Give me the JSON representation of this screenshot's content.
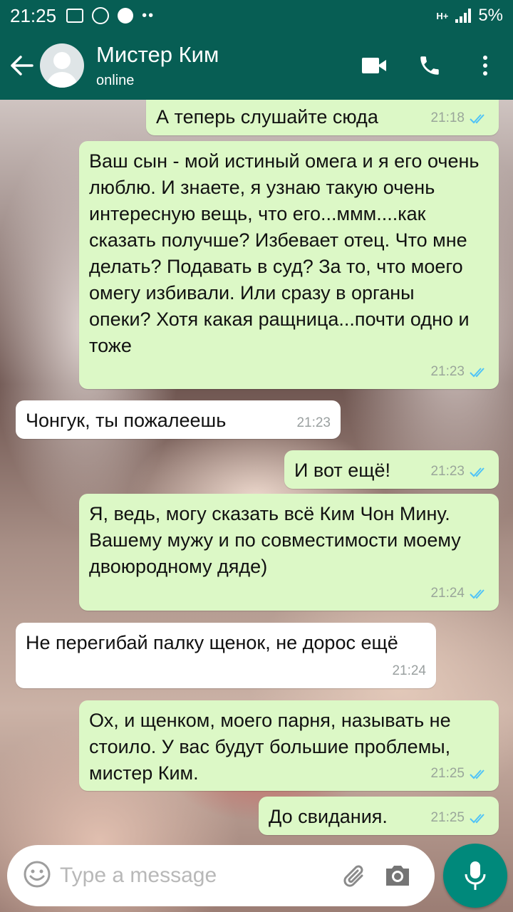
{
  "status_bar": {
    "time": "21:25",
    "network": "H+",
    "battery": "5%"
  },
  "header": {
    "contact_name": "Мистер Ким",
    "contact_status": "online"
  },
  "messages": [
    {
      "direction": "out",
      "text": "А теперь слушайте сюда",
      "time": "21:18",
      "read": true
    },
    {
      "direction": "out",
      "text": "Ваш сын - мой истиный омега и я его очень люблю. И знаете, я узнаю такую очень интересную вещь, что его...ммм....как сказать получше? Избевает отец. Что мне делать? Подавать в суд? За то, что моего омегу избивали. Или сразу в органы опеки? Хотя какая ращница...почти одно и тоже",
      "time": "21:23",
      "read": true
    },
    {
      "direction": "in",
      "text": "Чонгук, ты пожалеешь",
      "time": "21:23"
    },
    {
      "direction": "out",
      "text": "И вот ещё!",
      "time": "21:23",
      "read": true
    },
    {
      "direction": "out",
      "text": "Я, ведь, могу сказать всё Ким Чон Мину. Вашему мужу и по совместимости моему двоюродному дяде)",
      "time": "21:24",
      "read": true
    },
    {
      "direction": "in",
      "text": "Не перегибай палку щенок, не дорос ещё",
      "time": "21:24"
    },
    {
      "direction": "out",
      "text": "Ох, и щенком, моего парня, называть не стоило. У вас будут большие проблемы, мистер Ким.",
      "time": "21:25",
      "read": true
    },
    {
      "direction": "out",
      "text": "До свидания.",
      "time": "21:25",
      "read": true
    }
  ],
  "input": {
    "placeholder": "Type a message",
    "value": ""
  },
  "icons": {
    "back": "arrow-left-icon",
    "video": "video-call-icon",
    "call": "phone-icon",
    "menu": "more-vertical-icon",
    "emoji": "emoji-icon",
    "attach": "paperclip-icon",
    "camera": "camera-icon",
    "mic": "microphone-icon"
  },
  "colors": {
    "header": "#075e54",
    "outgoing_bubble": "#dcf8c6",
    "incoming_bubble": "#ffffff",
    "read_ticks": "#4fc3f7",
    "mic_button": "#00897b"
  }
}
